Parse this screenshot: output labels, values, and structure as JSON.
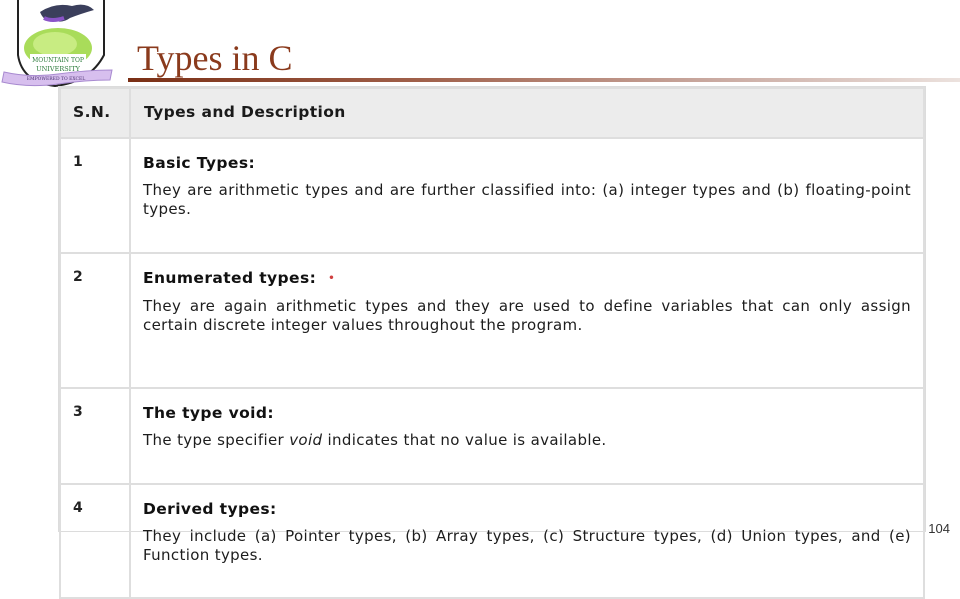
{
  "logo": {
    "name": "Mountain Top University",
    "text_line1": "MOUNTAIN TOP",
    "text_line2": "UNIVERSITY",
    "motto": "EMPOWERED TO EXCEL",
    "icon": "eagle-crest-logo"
  },
  "slide": {
    "title": "Types in C",
    "page_number": "104",
    "title_color": "#8a3a1c"
  },
  "table": {
    "headers": {
      "sn": "S.N.",
      "description": "Types and Description"
    },
    "rows": [
      {
        "sn": "1",
        "title": "Basic Types:",
        "description": "They are arithmetic types and are further classified into: (a) integer types and (b) floating-point types."
      },
      {
        "sn": "2",
        "title": "Enumerated types:",
        "marker": "•",
        "description": "They are again arithmetic types and they are used to define variables that can only assign certain discrete integer values throughout the program."
      },
      {
        "sn": "3",
        "title": "The type void:",
        "description_before": "The type specifier ",
        "description_em": "void",
        "description_after": " indicates that no value is available."
      },
      {
        "sn": "4",
        "title": "Derived types:",
        "description": "They include (a) Pointer types, (b) Array types, (c) Structure types, (d) Union types, and (e) Function types."
      }
    ]
  }
}
